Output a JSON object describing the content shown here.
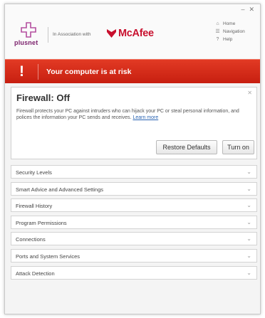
{
  "window_controls": {
    "minimize": "–",
    "close": "✕"
  },
  "header": {
    "logo_text": "plusnet",
    "association_text": "In Association with",
    "partner_name": "McAfee",
    "nav": [
      {
        "icon": "home-icon",
        "glyph": "⌂",
        "label": "Home"
      },
      {
        "icon": "navigation-icon",
        "glyph": "☰",
        "label": "Navigation"
      },
      {
        "icon": "help-icon",
        "glyph": "?",
        "label": "Help"
      }
    ]
  },
  "banner": {
    "icon": "!",
    "message": "Your computer is at risk",
    "color": "#d32a17"
  },
  "firewall": {
    "title": "Firewall: Off",
    "description": "Firewall protects your PC against intruders who can hijack your PC or steal personal information, and polices the information your PC sends and receives.",
    "learn_more": "Learn more",
    "restore_label": "Restore Defaults",
    "turn_on_label": "Turn on",
    "close": "✕"
  },
  "sections": [
    {
      "label": "Security Levels"
    },
    {
      "label": "Smart Advice and Advanced Settings"
    },
    {
      "label": "Firewall History"
    },
    {
      "label": "Program Permissions"
    },
    {
      "label": "Connections"
    },
    {
      "label": "Ports and System Services"
    },
    {
      "label": "Attack Detection"
    }
  ],
  "chevron": "⌄",
  "colors": {
    "brand_plusnet": "#7a1f6b",
    "brand_mcafee": "#c8102e",
    "link": "#2a64b2"
  }
}
